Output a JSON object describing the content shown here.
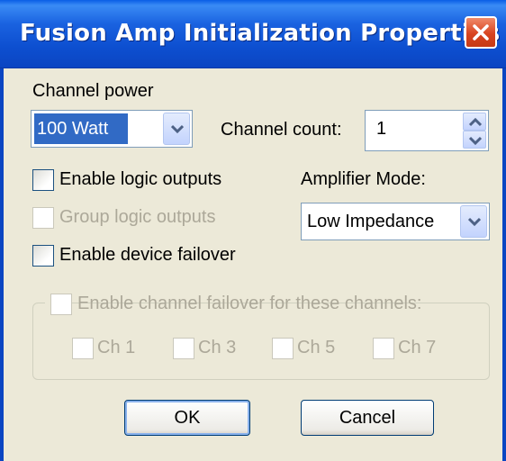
{
  "window": {
    "title": "Fusion Amp Initialization Properties",
    "close_icon": "close-icon"
  },
  "channel_power": {
    "label": "Channel power",
    "selected": "100 Watt"
  },
  "channel_count": {
    "label": "Channel count:",
    "value": "1"
  },
  "checkboxes": {
    "enable_logic_outputs": {
      "label": "Enable logic outputs",
      "checked": false,
      "enabled": true
    },
    "group_logic_outputs": {
      "label": "Group logic outputs",
      "checked": false,
      "enabled": false
    },
    "enable_device_failover": {
      "label": "Enable device failover",
      "checked": false,
      "enabled": true
    }
  },
  "amplifier_mode": {
    "label": "Amplifier Mode:",
    "selected": "Low Impedance"
  },
  "channel_failover": {
    "label": "Enable channel failover for these channels:",
    "channels": [
      "Ch 1",
      "Ch 3",
      "Ch 5",
      "Ch 7"
    ]
  },
  "buttons": {
    "ok": "OK",
    "cancel": "Cancel"
  },
  "colors": {
    "titlebar": "#0b45c2",
    "dialog_bg": "#ece9d8",
    "selection": "#316ac5",
    "disabled_text": "#aca899",
    "close_button": "#d8441f"
  }
}
